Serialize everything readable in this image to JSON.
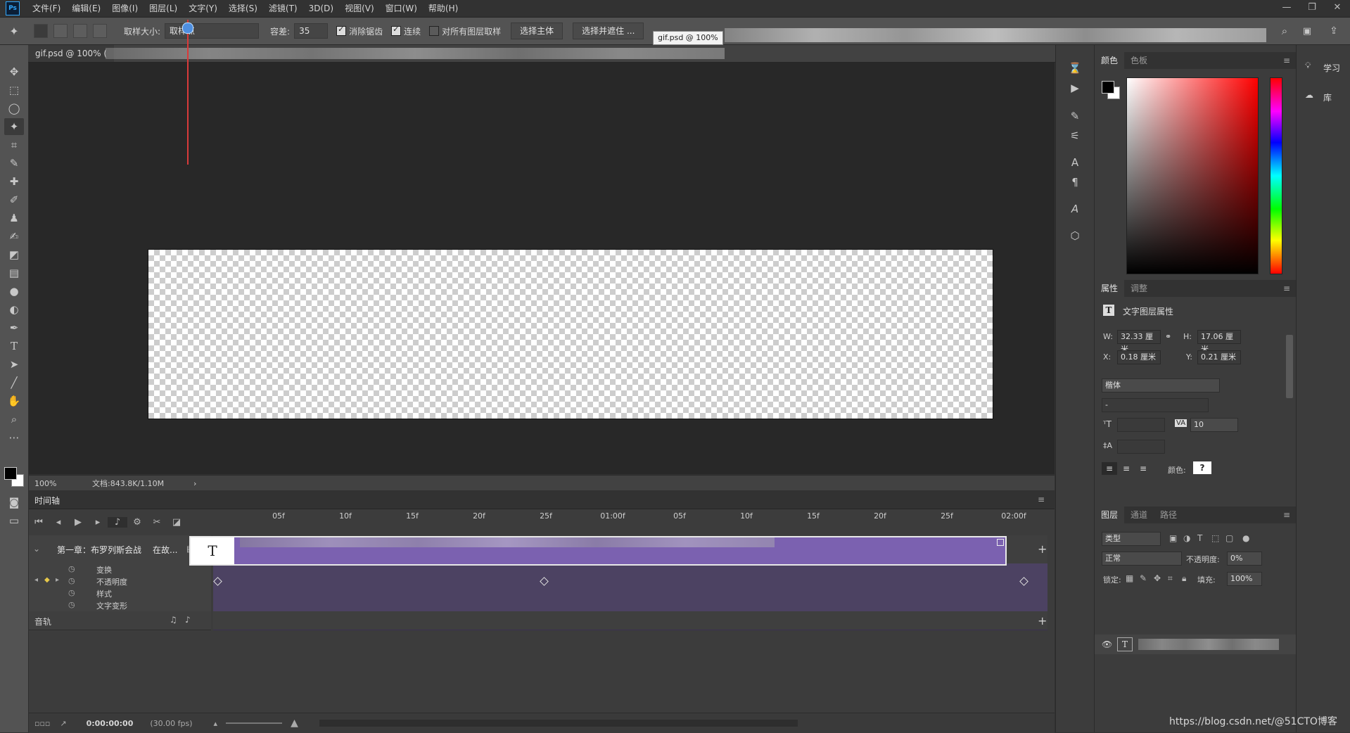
{
  "app": {
    "logo": "Ps"
  },
  "menu": [
    "文件(F)",
    "编辑(E)",
    "图像(I)",
    "图层(L)",
    "文字(Y)",
    "选择(S)",
    "滤镜(T)",
    "3D(D)",
    "视图(V)",
    "窗口(W)",
    "帮助(H)"
  ],
  "window_controls": {
    "minimize": "—",
    "restore": "❐",
    "close": "✕"
  },
  "options": {
    "sample_size_label": "取样大小:",
    "sample_size_value": "取样点",
    "tolerance_label": "容差:",
    "tolerance_value": "35",
    "antialias_label": "消除锯齿",
    "contiguous_label": "连续",
    "sample_all_label": "对所有图层取样",
    "select_subject": "选择主体",
    "select_mask": "选择并遮住 ..."
  },
  "tooltip": "gif.psd @ 100%",
  "doc_tab": "gif.psd @ 100% (",
  "status": {
    "zoom": "100%",
    "doc_info": "文档:843.8K/1.10M",
    "arrow": "›"
  },
  "right_panels": {
    "color_tabs": [
      "颜色",
      "色板"
    ],
    "props_tabs": [
      "属性",
      "调整"
    ],
    "props_title": "文字图层属性",
    "w_label": "W:",
    "w_value": "32.33 厘米",
    "h_label": "H:",
    "h_value": "17.06 厘米",
    "x_label": "X:",
    "x_value": "0.18 厘米",
    "y_label": "Y:",
    "y_value": "0.21 厘米",
    "font_family": "楷体",
    "font_style": "-",
    "tracking_value": "10",
    "color_label": "颜色:",
    "color_value": "?",
    "layers_tabs": [
      "图层",
      "通道",
      "路径"
    ],
    "layer_filter": "类型",
    "blend_mode": "正常",
    "opacity_label": "不透明度:",
    "opacity_value": "0%",
    "lock_label": "锁定:",
    "fill_label": "填充:",
    "fill_value": "100%"
  },
  "far_right": {
    "learn": "学习",
    "library": "库"
  },
  "timeline": {
    "title": "时间轴",
    "ticks": [
      "05f",
      "10f",
      "15f",
      "20f",
      "25f",
      "01:00f",
      "05f",
      "10f",
      "15f",
      "20f",
      "25f",
      "02:00f"
    ],
    "track_name": "第一章：布罗列斯会战",
    "track_extra": "在故...",
    "properties": [
      "变换",
      "不透明度",
      "样式",
      "文字变形"
    ],
    "audio_label": "音轨",
    "timecode": "0:00:00:00",
    "fps": "(30.00 fps)",
    "clip_glyph": "T"
  },
  "watermark": "https://blog.csdn.net/@51CTO博客",
  "colors": {
    "accent": "#7b61b0",
    "playhead": "#d93a3a",
    "knob": "#4f8fe0"
  }
}
